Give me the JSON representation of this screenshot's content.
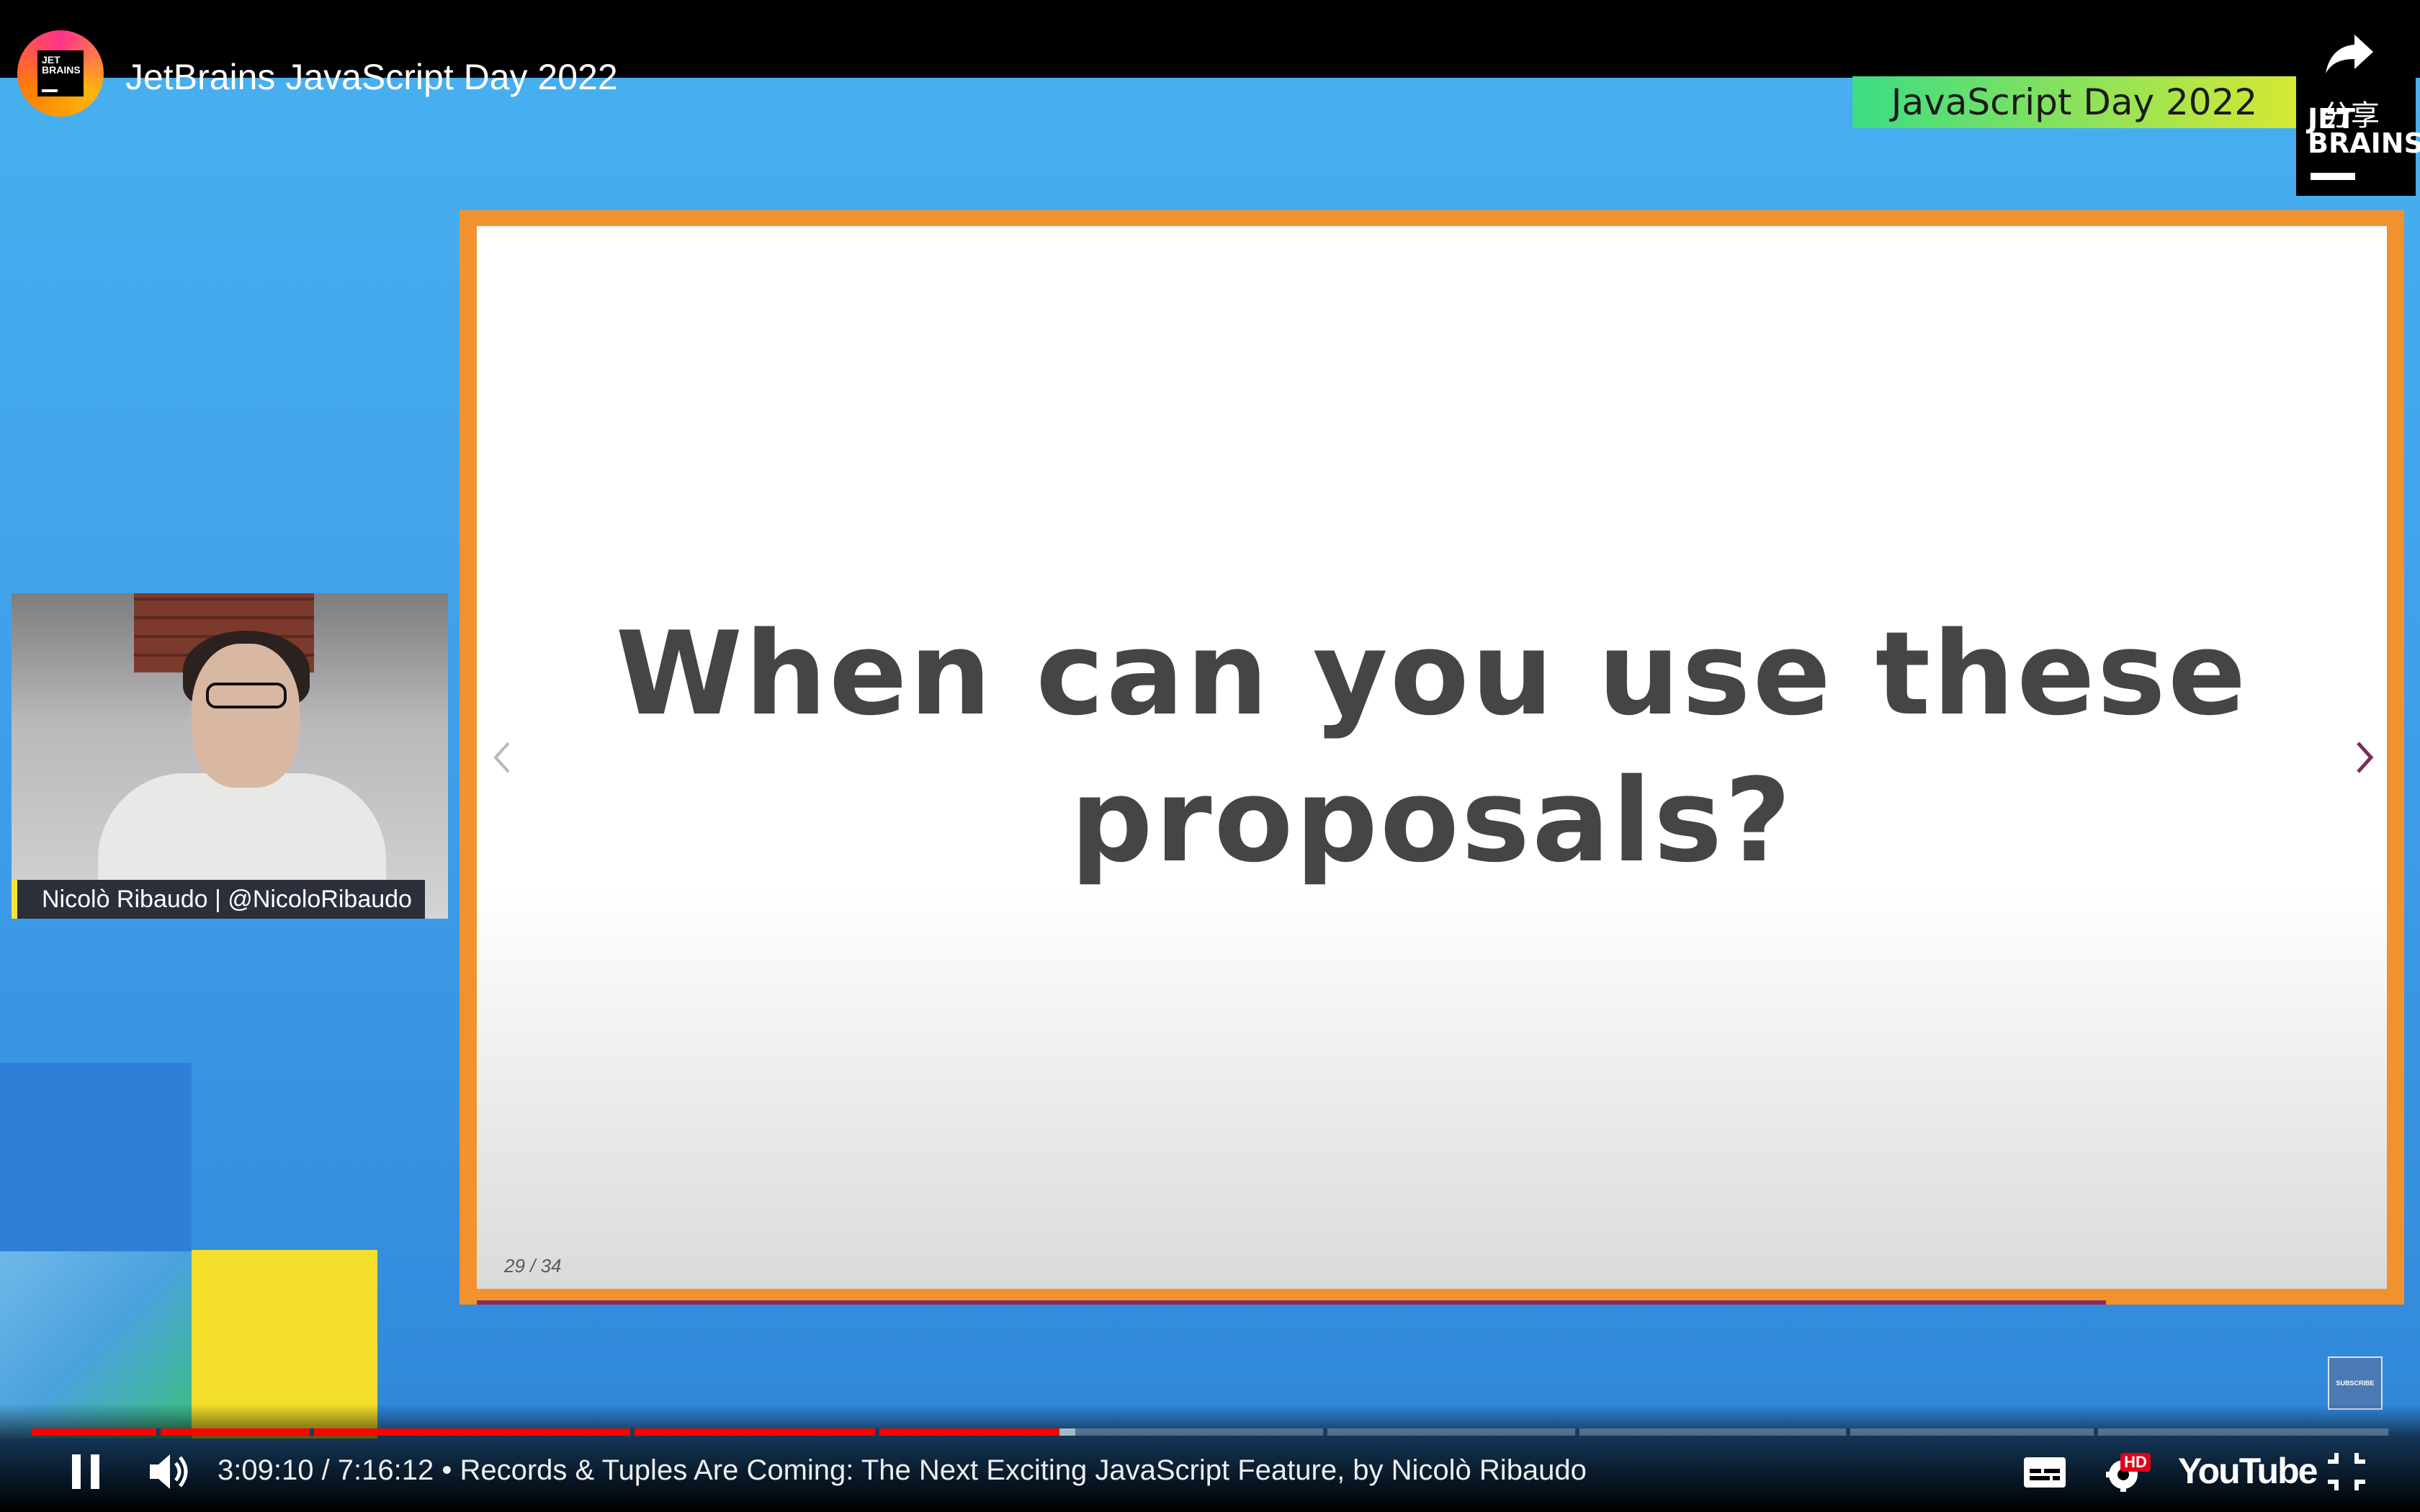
{
  "header": {
    "title": "JetBrains JavaScript Day 2022",
    "channel_logo_text": "JET\nBRAINS",
    "share_label": "分享",
    "event_banner": "JavaScript Day 2022",
    "brand_logo_text": "JET\nBRAINS"
  },
  "slide": {
    "heading_line1": "When can you use these",
    "heading_line2": "proposals?",
    "counter": "29 / 34",
    "progress": 0.853
  },
  "speaker": {
    "lower_third": "Nicolò Ribaudo | @NicoloRibaudo"
  },
  "overlay": {
    "subscribe_label": "SUBSCRIBE"
  },
  "player": {
    "played_fraction": 0.436,
    "buffered_fraction": 0.443,
    "time_and_title": "3:09:10 / 7:16:12 • Records & Tuples Are Coming: The Next Exciting JavaScript Feature, by Nicolò Ribaudo",
    "hd_badge": "HD",
    "brand": "YouTube"
  },
  "icons": [
    "share-icon",
    "pause-icon",
    "volume-icon",
    "captions-icon",
    "settings-icon",
    "exit-fullscreen-icon",
    "chevron-left-icon",
    "chevron-right-icon"
  ]
}
